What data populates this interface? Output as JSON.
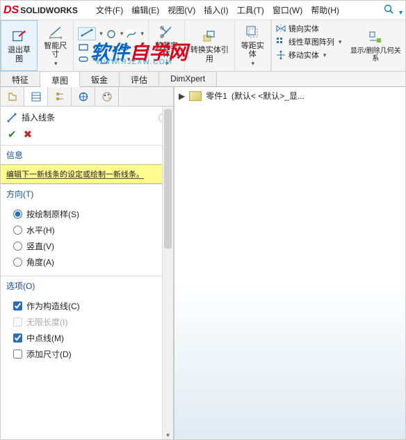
{
  "title": {
    "brand": "SOLIDWORKS"
  },
  "menus": [
    "文件(F)",
    "编辑(E)",
    "视图(V)",
    "插入(I)",
    "工具(T)",
    "窗口(W)",
    "帮助(H)"
  ],
  "ribbon": {
    "exit_sketch": "退出草图",
    "smart_dim": "智能尺寸",
    "trim": "剪裁实体",
    "convert": "转换实体引用",
    "offset": "等距实体",
    "mirror": "镜向实体",
    "linear_pattern": "线性草图阵列",
    "move": "移动实体",
    "display_delete": "显示/删除几何关系"
  },
  "tabs": [
    "特征",
    "草图",
    "钣金",
    "评估",
    "DimXpert"
  ],
  "active_tab": 1,
  "panel": {
    "title": "插入线条",
    "info_head": "信息",
    "info_text": "编辑下一新线条的设定或绘制一新线条。",
    "direction_head": "方向(T)",
    "direction_options": [
      "按绘制原样(S)",
      "水平(H)",
      "竖直(V)",
      "角度(A)"
    ],
    "direction_selected": 0,
    "options_head": "选项(O)",
    "options": [
      {
        "label": "作为构造线(C)",
        "checked": true,
        "enabled": true
      },
      {
        "label": "无限长度(I)",
        "checked": false,
        "enabled": false
      },
      {
        "label": "中点线(M)",
        "checked": true,
        "enabled": true
      },
      {
        "label": "添加尺寸(D)",
        "checked": false,
        "enabled": true
      }
    ]
  },
  "breadcrumb": {
    "part": "零件1",
    "state": "(默认< <默认>_显..."
  },
  "watermark": {
    "text": "软件自学网",
    "url": "WWW.RJZXW.COM"
  }
}
